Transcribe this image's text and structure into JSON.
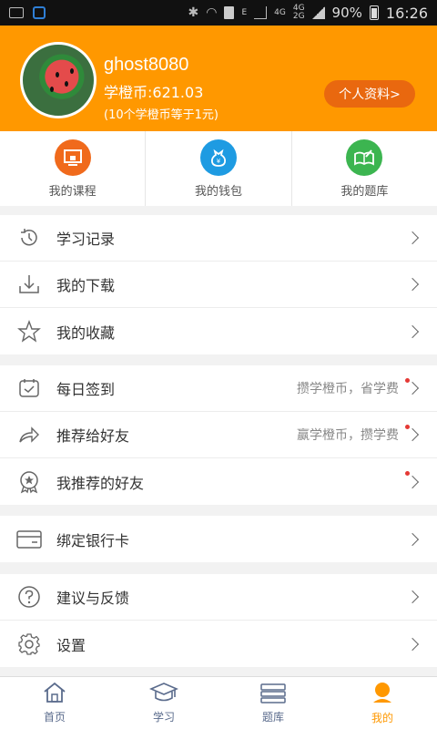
{
  "status_bar": {
    "network_small": "E",
    "network_4g": "4G",
    "network_4g2": "4G",
    "network_2g": "2G",
    "battery_pct": "90%",
    "time": "16:26"
  },
  "profile": {
    "username": "ghost8080",
    "coins": "学橙币:621.03",
    "coin_note": "(10个学橙币等于1元)",
    "profile_button": "个人资料>"
  },
  "quick": [
    {
      "label": "我的课程",
      "icon": "course-icon",
      "color": "#f06a1c"
    },
    {
      "label": "我的钱包",
      "icon": "wallet-icon",
      "color": "#1e9be2"
    },
    {
      "label": "我的题库",
      "icon": "question-bank-icon",
      "color": "#3cb550"
    }
  ],
  "groups": {
    "g1": [
      {
        "label": "学习记录",
        "icon": "history-icon"
      },
      {
        "label": "我的下载",
        "icon": "download-icon"
      },
      {
        "label": "我的收藏",
        "icon": "star-icon"
      }
    ],
    "g2": [
      {
        "label": "每日签到",
        "hint": "攒学橙币，省学费",
        "icon": "calendar-check-icon"
      },
      {
        "label": "推荐给好友",
        "hint": "赢学橙币，攒学费",
        "icon": "share-icon"
      },
      {
        "label": "我推荐的好友",
        "hint": "",
        "icon": "badge-icon"
      }
    ],
    "g3": [
      {
        "label": "绑定银行卡",
        "icon": "bank-card-icon"
      }
    ],
    "g4": [
      {
        "label": "建议与反馈",
        "icon": "question-icon"
      },
      {
        "label": "设置",
        "icon": "gear-icon"
      }
    ]
  },
  "tabs": [
    {
      "label": "首页",
      "icon": "home-icon"
    },
    {
      "label": "学习",
      "icon": "graduation-cap-icon"
    },
    {
      "label": "题库",
      "icon": "books-icon"
    },
    {
      "label": "我的",
      "icon": "user-icon"
    }
  ],
  "colors": {
    "accent": "#ff9800",
    "accent_dark": "#e9680f",
    "notify_dot": "#e53935"
  }
}
